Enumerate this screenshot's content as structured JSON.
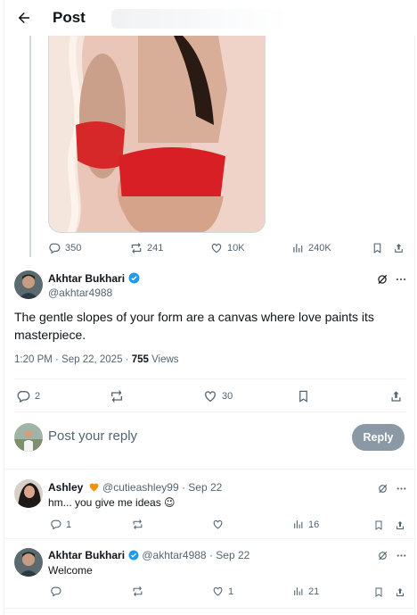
{
  "header": {
    "title": "Post"
  },
  "original_post": {
    "stats": {
      "replies": "350",
      "reposts": "241",
      "likes": "10K",
      "views": "240K"
    }
  },
  "main_post": {
    "author_name": "Akhtar Bukhari",
    "author_handle": "@akhtar4988",
    "text": "The gentle slopes of your form are a canvas where love paints its masterpiece.",
    "time": "1:20 PM · Sep 22, 2025 · ",
    "views_count": "755",
    "views_label": " Views",
    "stats": {
      "replies": "2",
      "reposts": "",
      "likes": "30"
    }
  },
  "compose": {
    "placeholder": "Post your reply",
    "button_label": "Reply"
  },
  "replies": [
    {
      "author_name": "Ashley",
      "author_handle": "@cutieashley99",
      "date": " · Sep 22",
      "text": "hm... you give me ideas 😉",
      "stats": {
        "replies": "1",
        "reposts": "",
        "likes": "",
        "views": "16"
      }
    },
    {
      "author_name": "Akhtar Bukhari",
      "author_handle": "@akhtar4988",
      "date": " · Sep 22",
      "text": "Welcome",
      "stats": {
        "replies": "",
        "reposts": "",
        "likes": "1",
        "views": "21"
      }
    }
  ],
  "colors": {
    "accent": "#1d9bf0",
    "verified": "#1d9bf0",
    "muted": "#536471",
    "heart_emoji": "#f4900c"
  }
}
